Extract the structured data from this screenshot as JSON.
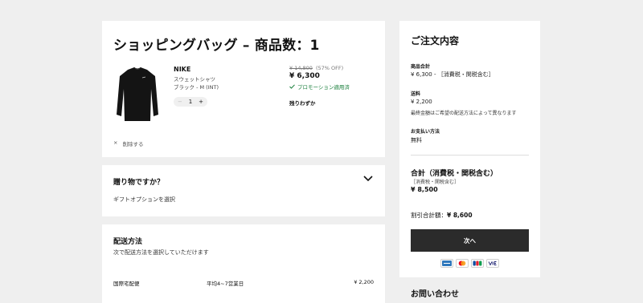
{
  "cart": {
    "title": "ショッピングバッグ – 商品数：1",
    "item": {
      "brand": "NIKE",
      "name": "スウェットシャツ",
      "variant": "ブラック - M (INT)",
      "quantity": "1",
      "minus": "−",
      "plus": "+",
      "price_original": "¥ 14,800",
      "discount": "(57% OFF)",
      "price": "¥ 6,300",
      "promo": "プロモーション適用済",
      "stock": "残りわずか"
    },
    "remove_label": "削除する",
    "remove_icon": "×"
  },
  "gift": {
    "title": "贈り物ですか？",
    "text": "ギフトオプションを選択"
  },
  "shipping": {
    "title": "配送方法",
    "subtitle": "次で配送方法を選択していただけます",
    "method": {
      "name": "国際宅配便",
      "duration": "平均4~7営業日",
      "price": "¥ 2,200"
    }
  },
  "summary": {
    "title": "ご注文内容",
    "subtotal_label": "商品合計",
    "subtotal_value": "¥ 6,300 - ［消費税・関税含む］",
    "shipping_label": "送料",
    "shipping_value": "¥ 2,200",
    "shipping_note": "最終金額はご希望の配送方法によって異なります",
    "payment_label": "お支払い方法",
    "payment_value": "無料",
    "total_title": "合計（消費税・関税含む）",
    "total_note": "［消費税・関税含む］",
    "total_value": "¥ 8,500",
    "discount_label": "割引合計額：",
    "discount_value": "¥ 8,600",
    "next_button": "次へ",
    "payment_icons": [
      "amex-icon",
      "mastercard-icon",
      "jcb-icon",
      "visa-icon"
    ]
  },
  "contact": {
    "title": "お問い合わせ"
  },
  "colors": {
    "background": "#efefef",
    "card": "#ffffff",
    "button": "#2b2b2b",
    "promo_green": "#1a7f3c"
  }
}
